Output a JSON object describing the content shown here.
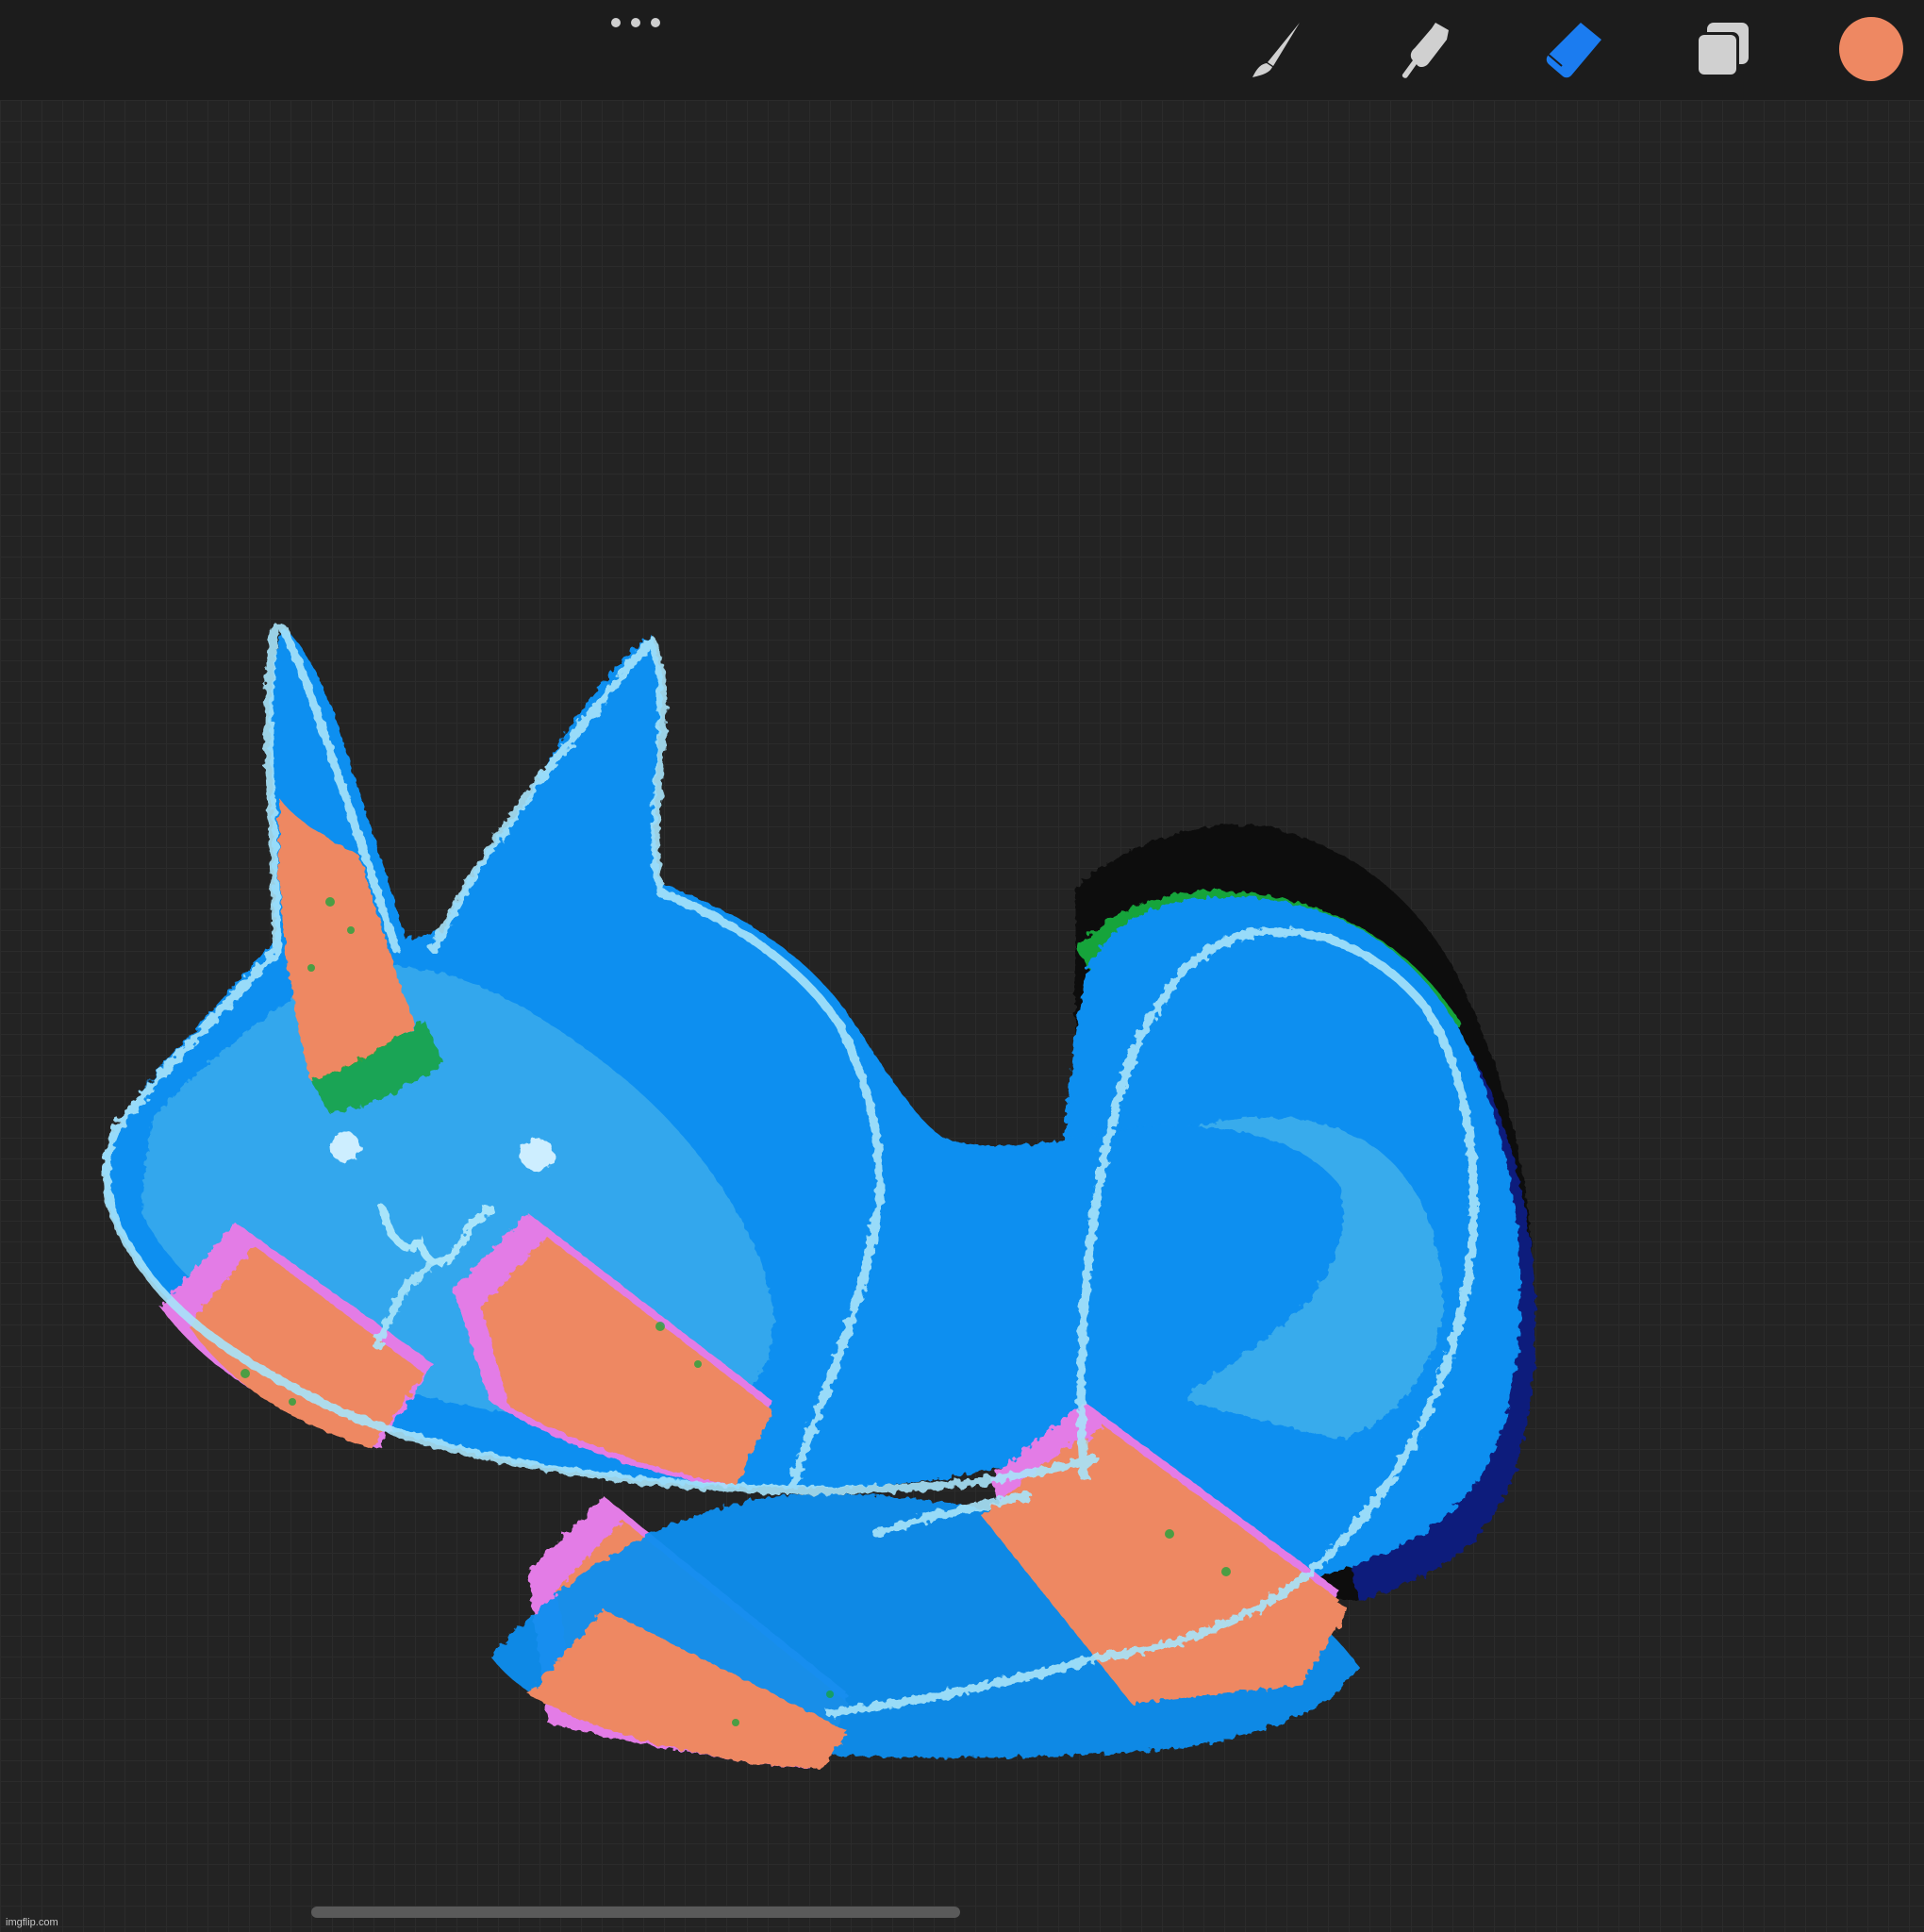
{
  "toolbar": {
    "menu_icon": "more-dots-icon",
    "tools": [
      {
        "name": "brush",
        "icon": "brush-icon",
        "active": false
      },
      {
        "name": "smudge",
        "icon": "smudge-icon",
        "active": false
      },
      {
        "name": "eraser",
        "icon": "eraser-icon",
        "active": true
      },
      {
        "name": "layers",
        "icon": "layers-icon",
        "active": false
      }
    ],
    "current_color": "#EE8862",
    "active_tool_color": "#1B7CF0",
    "inactive_tool_color": "#D0D0D0"
  },
  "canvas": {
    "background": "#232323",
    "artwork_colors": {
      "primary_blue": "#0F8FF0",
      "light_blue": "#3FB0EC",
      "outline": "#A8E4FA",
      "orange": "#EE8862",
      "pink": "#E37CE6",
      "green": "#16A43A",
      "navy": "#101A7C"
    }
  },
  "watermark": {
    "text": "imgflip.com"
  }
}
